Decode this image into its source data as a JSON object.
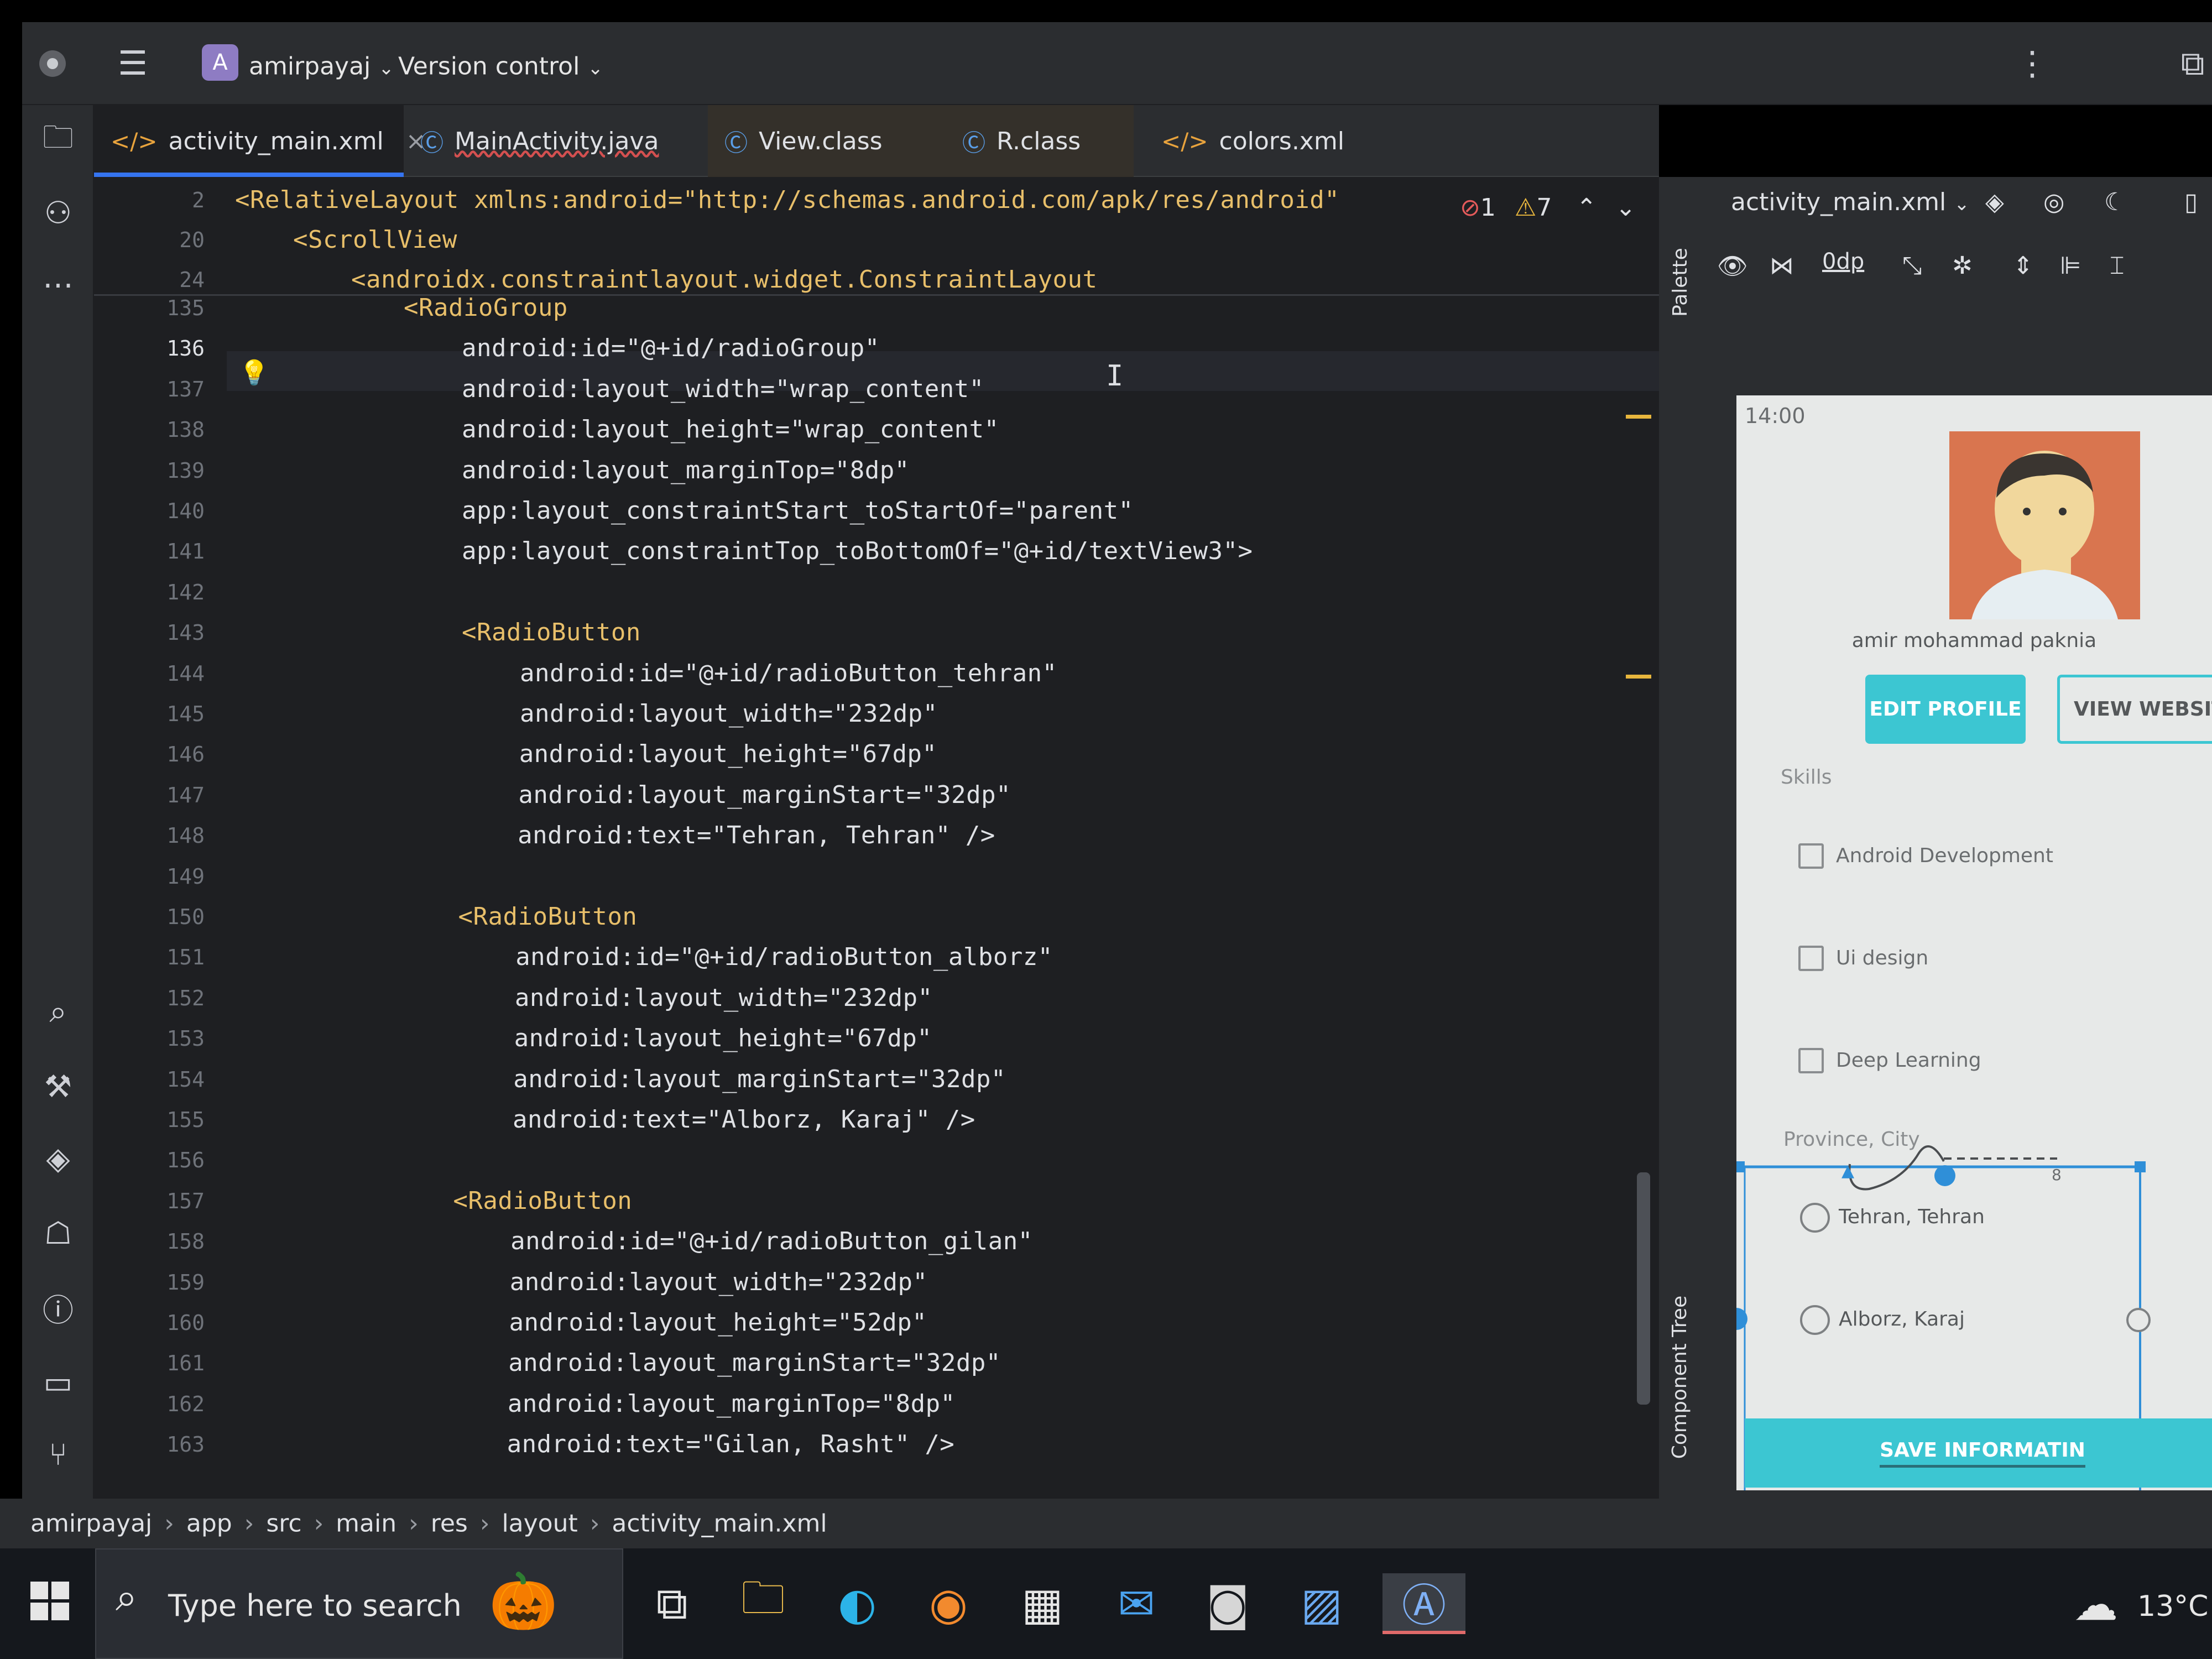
{
  "titlebar": {
    "project_badge": "A",
    "project_name": "amirpayaj",
    "vcs_label": "Version control"
  },
  "tabs": [
    {
      "label": "activity_main.xml",
      "icon": "xml-icon"
    },
    {
      "label": "MainActivity.java",
      "icon": "class-icon"
    },
    {
      "label": "View.class",
      "icon": "class-icon"
    },
    {
      "label": "R.class",
      "icon": "class-icon"
    },
    {
      "label": "colors.xml",
      "icon": "xml-icon"
    }
  ],
  "inspections": {
    "errors": "1",
    "warnings": "7"
  },
  "sticky_lines": [
    {
      "num": "2",
      "text": "<RelativeLayout xmlns:android=\"http://schemas.android.com/apk/res/android\""
    },
    {
      "num": "20",
      "text": "<ScrollView"
    },
    {
      "num": "24",
      "text": "<androidx.constraintlayout.widget.ConstraintLayout"
    }
  ],
  "code_lines": [
    {
      "num": "135",
      "text": "<RadioGroup"
    },
    {
      "num": "136",
      "text": "android:id=\"@+id/radioGroup\""
    },
    {
      "num": "137",
      "text": "android:layout_width=\"wrap_content\""
    },
    {
      "num": "138",
      "text": "android:layout_height=\"wrap_content\""
    },
    {
      "num": "139",
      "text": "android:layout_marginTop=\"8dp\""
    },
    {
      "num": "140",
      "text": "app:layout_constraintStart_toStartOf=\"parent\""
    },
    {
      "num": "141",
      "text": "app:layout_constraintTop_toBottomOf=\"@+id/textView3\">"
    },
    {
      "num": "142",
      "text": ""
    },
    {
      "num": "143",
      "text": "<RadioButton"
    },
    {
      "num": "144",
      "text": "android:id=\"@+id/radioButton_tehran\""
    },
    {
      "num": "145",
      "text": "android:layout_width=\"232dp\""
    },
    {
      "num": "146",
      "text": "android:layout_height=\"67dp\""
    },
    {
      "num": "147",
      "text": "android:layout_marginStart=\"32dp\""
    },
    {
      "num": "148",
      "text": "android:text=\"Tehran, Tehran\" />"
    },
    {
      "num": "149",
      "text": ""
    },
    {
      "num": "150",
      "text": "<RadioButton"
    },
    {
      "num": "151",
      "text": "android:id=\"@+id/radioButton_alborz\""
    },
    {
      "num": "152",
      "text": "android:layout_width=\"232dp\""
    },
    {
      "num": "153",
      "text": "android:layout_height=\"67dp\""
    },
    {
      "num": "154",
      "text": "android:layout_marginStart=\"32dp\""
    },
    {
      "num": "155",
      "text": "android:text=\"Alborz, Karaj\" />"
    },
    {
      "num": "156",
      "text": ""
    },
    {
      "num": "157",
      "text": "<RadioButton"
    },
    {
      "num": "158",
      "text": "android:id=\"@+id/radioButton_gilan\""
    },
    {
      "num": "159",
      "text": "android:layout_width=\"232dp\""
    },
    {
      "num": "160",
      "text": "android:layout_height=\"52dp\""
    },
    {
      "num": "161",
      "text": "android:layout_marginStart=\"32dp\""
    },
    {
      "num": "162",
      "text": "android:layout_marginTop=\"8dp\""
    },
    {
      "num": "163",
      "text": "android:text=\"Gilan, Rasht\" />"
    }
  ],
  "side_labels": {
    "palette": "Palette",
    "component_tree": "Component Tree"
  },
  "preview": {
    "file_selector": "activity_main.xml",
    "margin_value": "0dp",
    "time": "14:00",
    "name": "amir mohammad paknia",
    "edit_profile": "EDIT PROFILE",
    "view_website": "VIEW WEBSITE",
    "skills_label": "Skills",
    "skills": [
      "Android Development",
      "Ui design",
      "Deep Learning"
    ],
    "province_label": "Province, City",
    "cities": [
      "Tehran, Tehran",
      "Alborz, Karaj"
    ],
    "save_button": "SAVE INFORMATIN",
    "constraint_value": "8"
  },
  "breadcrumbs": [
    "amirpayaj",
    "app",
    "src",
    "main",
    "res",
    "layout",
    "activity_main.xml"
  ],
  "taskbar": {
    "search_placeholder": "Type here to search",
    "weather": "13°C"
  }
}
